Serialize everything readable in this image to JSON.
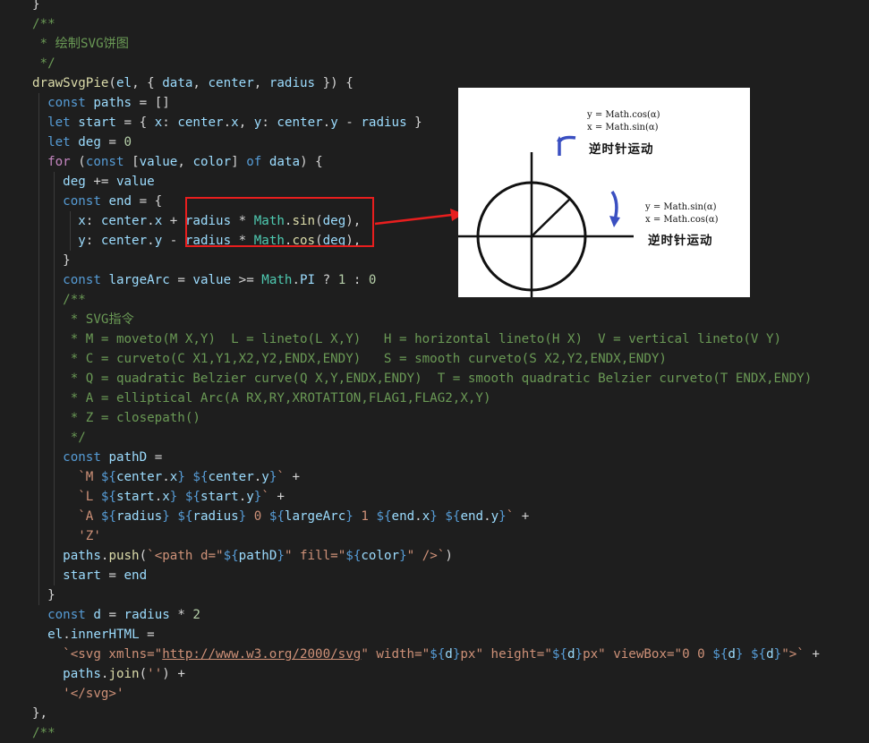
{
  "code": {
    "lines": [
      [
        [
          "o",
          "}"
        ]
      ],
      [
        [
          "c",
          "/**"
        ]
      ],
      [
        [
          "c",
          " * 绘制SVG饼图"
        ]
      ],
      [
        [
          "c",
          " */"
        ]
      ],
      [
        [
          "f",
          "drawSvgPie"
        ],
        [
          "o",
          "("
        ],
        [
          "v",
          "el"
        ],
        [
          "o",
          ", { "
        ],
        [
          "v",
          "data"
        ],
        [
          "o",
          ", "
        ],
        [
          "v",
          "center"
        ],
        [
          "o",
          ", "
        ],
        [
          "v",
          "radius"
        ],
        [
          "o",
          " }) {"
        ]
      ],
      [
        [
          "o",
          "  "
        ],
        [
          "k",
          "const"
        ],
        [
          "o",
          " "
        ],
        [
          "v",
          "paths"
        ],
        [
          "o",
          " = []"
        ]
      ],
      [
        [
          "o",
          "  "
        ],
        [
          "k",
          "let"
        ],
        [
          "o",
          " "
        ],
        [
          "v",
          "start"
        ],
        [
          "o",
          " = { "
        ],
        [
          "v",
          "x"
        ],
        [
          "o",
          ": "
        ],
        [
          "v",
          "center"
        ],
        [
          "o",
          "."
        ],
        [
          "v",
          "x"
        ],
        [
          "o",
          ", "
        ],
        [
          "v",
          "y"
        ],
        [
          "o",
          ": "
        ],
        [
          "v",
          "center"
        ],
        [
          "o",
          "."
        ],
        [
          "v",
          "y"
        ],
        [
          "o",
          " - "
        ],
        [
          "v",
          "radius"
        ],
        [
          "o",
          " }"
        ]
      ],
      [
        [
          "o",
          "  "
        ],
        [
          "k",
          "let"
        ],
        [
          "o",
          " "
        ],
        [
          "v",
          "deg"
        ],
        [
          "o",
          " = "
        ],
        [
          "n",
          "0"
        ]
      ],
      [
        [
          "o",
          "  "
        ],
        [
          "ctl",
          "for"
        ],
        [
          "o",
          " ("
        ],
        [
          "k",
          "const"
        ],
        [
          "o",
          " ["
        ],
        [
          "v",
          "value"
        ],
        [
          "o",
          ", "
        ],
        [
          "v",
          "color"
        ],
        [
          "o",
          "] "
        ],
        [
          "k",
          "of"
        ],
        [
          "o",
          " "
        ],
        [
          "v",
          "data"
        ],
        [
          "o",
          ") {"
        ]
      ],
      [
        [
          "o",
          "    "
        ],
        [
          "v",
          "deg"
        ],
        [
          "o",
          " += "
        ],
        [
          "v",
          "value"
        ]
      ],
      [
        [
          "o",
          "    "
        ],
        [
          "k",
          "const"
        ],
        [
          "o",
          " "
        ],
        [
          "v",
          "end"
        ],
        [
          "o",
          " = {"
        ]
      ],
      [
        [
          "o",
          "      "
        ],
        [
          "v",
          "x"
        ],
        [
          "o",
          ": "
        ],
        [
          "v",
          "center"
        ],
        [
          "o",
          "."
        ],
        [
          "v",
          "x"
        ],
        [
          "o",
          " + "
        ],
        [
          "v",
          "radius"
        ],
        [
          "o",
          " * "
        ],
        [
          "cls",
          "Math"
        ],
        [
          "o",
          "."
        ],
        [
          "f",
          "sin"
        ],
        [
          "o",
          "("
        ],
        [
          "v",
          "deg"
        ],
        [
          "o",
          "),"
        ]
      ],
      [
        [
          "o",
          "      "
        ],
        [
          "v",
          "y"
        ],
        [
          "o",
          ": "
        ],
        [
          "v",
          "center"
        ],
        [
          "o",
          "."
        ],
        [
          "v",
          "y"
        ],
        [
          "o",
          " - "
        ],
        [
          "v",
          "radius"
        ],
        [
          "o",
          " * "
        ],
        [
          "cls",
          "Math"
        ],
        [
          "o",
          "."
        ],
        [
          "f",
          "cos"
        ],
        [
          "o",
          "("
        ],
        [
          "v",
          "deg"
        ],
        [
          "o",
          "),"
        ]
      ],
      [
        [
          "o",
          "    }"
        ]
      ],
      [
        [
          "o",
          "    "
        ],
        [
          "k",
          "const"
        ],
        [
          "o",
          " "
        ],
        [
          "v",
          "largeArc"
        ],
        [
          "o",
          " = "
        ],
        [
          "v",
          "value"
        ],
        [
          "o",
          " >= "
        ],
        [
          "cls",
          "Math"
        ],
        [
          "o",
          "."
        ],
        [
          "v",
          "PI"
        ],
        [
          "o",
          " ? "
        ],
        [
          "n",
          "1"
        ],
        [
          "o",
          " : "
        ],
        [
          "n",
          "0"
        ]
      ],
      [
        [
          "o",
          "    "
        ],
        [
          "c",
          "/**"
        ]
      ],
      [
        [
          "c",
          "     * SVG指令"
        ]
      ],
      [
        [
          "c",
          "     * M = moveto(M X,Y)  L = lineto(L X,Y)   H = horizontal lineto(H X)  V = vertical lineto(V Y)"
        ]
      ],
      [
        [
          "c",
          "     * C = curveto(C X1,Y1,X2,Y2,ENDX,ENDY)   S = smooth curveto(S X2,Y2,ENDX,ENDY)"
        ]
      ],
      [
        [
          "c",
          "     * Q = quadratic Belzier curve(Q X,Y,ENDX,ENDY)  T = smooth quadratic Belzier curveto(T ENDX,ENDY)"
        ]
      ],
      [
        [
          "c",
          "     * A = elliptical Arc(A RX,RY,XROTATION,FLAG1,FLAG2,X,Y)"
        ]
      ],
      [
        [
          "c",
          "     * Z = closepath()"
        ]
      ],
      [
        [
          "c",
          "     */"
        ]
      ],
      [
        [
          "o",
          "    "
        ],
        [
          "k",
          "const"
        ],
        [
          "o",
          " "
        ],
        [
          "v",
          "pathD"
        ],
        [
          "o",
          " ="
        ]
      ],
      [
        [
          "o",
          "      "
        ],
        [
          "s",
          "`M "
        ],
        [
          "k",
          "${"
        ],
        [
          "v",
          "center"
        ],
        [
          "o",
          "."
        ],
        [
          "v",
          "x"
        ],
        [
          "k",
          "}"
        ],
        [
          "s",
          " "
        ],
        [
          "k",
          "${"
        ],
        [
          "v",
          "center"
        ],
        [
          "o",
          "."
        ],
        [
          "v",
          "y"
        ],
        [
          "k",
          "}"
        ],
        [
          "s",
          "`"
        ],
        [
          "o",
          " +"
        ]
      ],
      [
        [
          "o",
          "      "
        ],
        [
          "s",
          "`L "
        ],
        [
          "k",
          "${"
        ],
        [
          "v",
          "start"
        ],
        [
          "o",
          "."
        ],
        [
          "v",
          "x"
        ],
        [
          "k",
          "}"
        ],
        [
          "s",
          " "
        ],
        [
          "k",
          "${"
        ],
        [
          "v",
          "start"
        ],
        [
          "o",
          "."
        ],
        [
          "v",
          "y"
        ],
        [
          "k",
          "}"
        ],
        [
          "s",
          "`"
        ],
        [
          "o",
          " +"
        ]
      ],
      [
        [
          "o",
          "      "
        ],
        [
          "s",
          "`A "
        ],
        [
          "k",
          "${"
        ],
        [
          "v",
          "radius"
        ],
        [
          "k",
          "}"
        ],
        [
          "s",
          " "
        ],
        [
          "k",
          "${"
        ],
        [
          "v",
          "radius"
        ],
        [
          "k",
          "}"
        ],
        [
          "s",
          " 0 "
        ],
        [
          "k",
          "${"
        ],
        [
          "v",
          "largeArc"
        ],
        [
          "k",
          "}"
        ],
        [
          "s",
          " 1 "
        ],
        [
          "k",
          "${"
        ],
        [
          "v",
          "end"
        ],
        [
          "o",
          "."
        ],
        [
          "v",
          "x"
        ],
        [
          "k",
          "}"
        ],
        [
          "s",
          " "
        ],
        [
          "k",
          "${"
        ],
        [
          "v",
          "end"
        ],
        [
          "o",
          "."
        ],
        [
          "v",
          "y"
        ],
        [
          "k",
          "}"
        ],
        [
          "s",
          "`"
        ],
        [
          "o",
          " +"
        ]
      ],
      [
        [
          "o",
          "      "
        ],
        [
          "s",
          "'Z'"
        ]
      ],
      [
        [
          "o",
          "    "
        ],
        [
          "v",
          "paths"
        ],
        [
          "o",
          "."
        ],
        [
          "f",
          "push"
        ],
        [
          "o",
          "("
        ],
        [
          "s",
          "`<path d=\""
        ],
        [
          "k",
          "${"
        ],
        [
          "v",
          "pathD"
        ],
        [
          "k",
          "}"
        ],
        [
          "s",
          "\" fill=\""
        ],
        [
          "k",
          "${"
        ],
        [
          "v",
          "color"
        ],
        [
          "k",
          "}"
        ],
        [
          "s",
          "\" />`"
        ],
        [
          "o",
          ")"
        ]
      ],
      [
        [
          "o",
          "    "
        ],
        [
          "v",
          "start"
        ],
        [
          "o",
          " = "
        ],
        [
          "v",
          "end"
        ]
      ],
      [
        [
          "o",
          "  }"
        ]
      ],
      [
        [
          "o",
          "  "
        ],
        [
          "k",
          "const"
        ],
        [
          "o",
          " "
        ],
        [
          "v",
          "d"
        ],
        [
          "o",
          " = "
        ],
        [
          "v",
          "radius"
        ],
        [
          "o",
          " * "
        ],
        [
          "n",
          "2"
        ]
      ],
      [
        [
          "o",
          "  "
        ],
        [
          "v",
          "el"
        ],
        [
          "o",
          "."
        ],
        [
          "v",
          "innerHTML"
        ],
        [
          "o",
          " ="
        ]
      ],
      [
        [
          "o",
          "    "
        ],
        [
          "s",
          "`<svg xmlns=\""
        ],
        [
          "su",
          "http://www.w3.org/2000/svg"
        ],
        [
          "s",
          "\" width=\""
        ],
        [
          "k",
          "${"
        ],
        [
          "v",
          "d"
        ],
        [
          "k",
          "}"
        ],
        [
          "s",
          "px\" height=\""
        ],
        [
          "k",
          "${"
        ],
        [
          "v",
          "d"
        ],
        [
          "k",
          "}"
        ],
        [
          "s",
          "px\" viewBox=\"0 0 "
        ],
        [
          "k",
          "${"
        ],
        [
          "v",
          "d"
        ],
        [
          "k",
          "}"
        ],
        [
          "s",
          " "
        ],
        [
          "k",
          "${"
        ],
        [
          "v",
          "d"
        ],
        [
          "k",
          "}"
        ],
        [
          "s",
          "\">`"
        ],
        [
          "o",
          " +"
        ]
      ],
      [
        [
          "o",
          "    "
        ],
        [
          "v",
          "paths"
        ],
        [
          "o",
          "."
        ],
        [
          "f",
          "join"
        ],
        [
          "o",
          "("
        ],
        [
          "s",
          "''"
        ],
        [
          "o",
          ") +"
        ]
      ],
      [
        [
          "o",
          "    "
        ],
        [
          "s",
          "'</svg>'"
        ]
      ],
      [
        [
          "o",
          "},"
        ]
      ],
      [
        [
          "c",
          "/**"
        ]
      ]
    ]
  },
  "diagram": {
    "top_note_line1": "y = Math.cos(α)",
    "top_note_line2": "x = Math.sin(α)",
    "top_label": "逆时针运动",
    "right_note_line1": "y = Math.sin(α)",
    "right_note_line2": "x = Math.cos(α)",
    "right_label": "逆时针运动"
  },
  "colors": {
    "background": "#1e1e1e",
    "highlight_box": "#e81e1e",
    "arrow": "#e81e1e",
    "diagram_arrows": "#3a4fc1"
  }
}
